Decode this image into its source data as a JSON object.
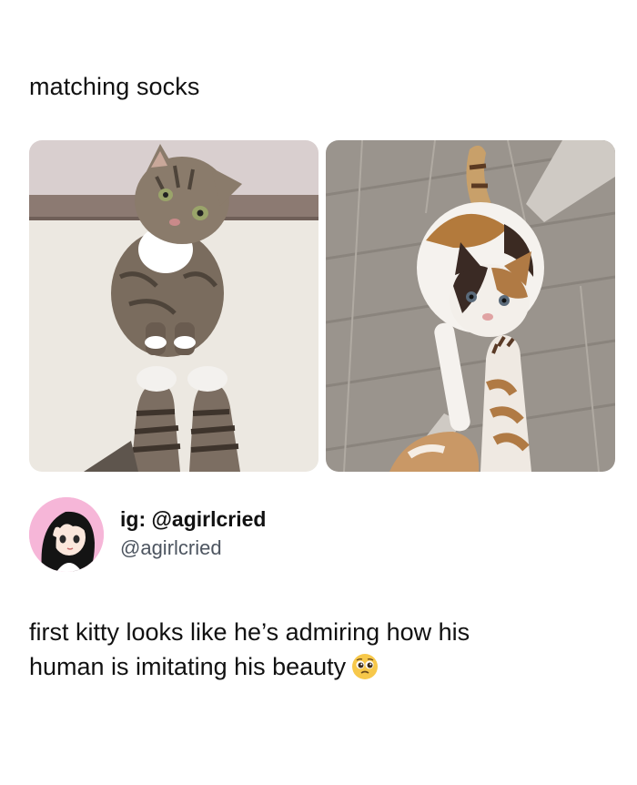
{
  "post": {
    "top_text": "matching socks",
    "photos": [
      {
        "name": "left-photo",
        "subject": "tabby cat looking up at feet in striped socks"
      },
      {
        "name": "right-photo",
        "subject": "calico cat lying next to feet in calico-patterned socks"
      }
    ]
  },
  "author": {
    "display_name": "ig: @agirlcried",
    "handle": "@agirlcried",
    "avatar_icon": "anime-girl-avatar-icon"
  },
  "body": {
    "line1": "first kitty looks like he’s admiring how his",
    "line2": "human is imitating his beauty",
    "emoji_icon": "pleading-face-emoji-icon"
  },
  "colors": {
    "text": "#111111",
    "handle": "#4d5560",
    "avatar_bg": "#f6b6d8"
  }
}
